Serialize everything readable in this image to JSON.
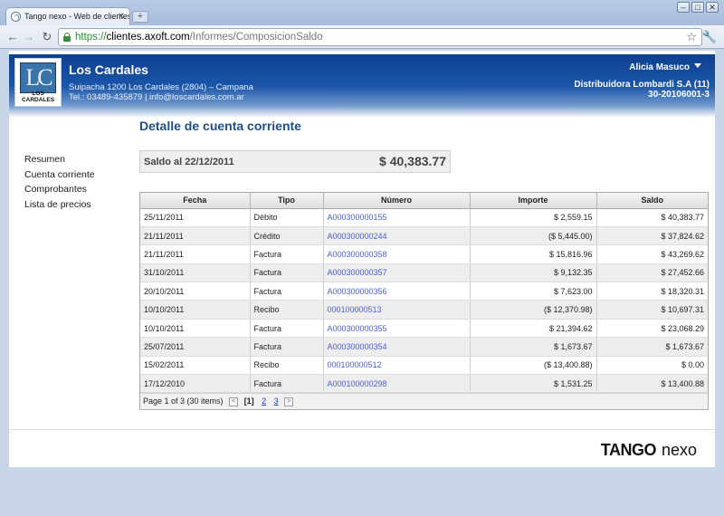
{
  "browser": {
    "tab_title": "Tango nexo - Web de clientes",
    "url_scheme": "https://",
    "url_host": "clientes.axoft.com",
    "url_path": "/Informes/ComposicionSaldo"
  },
  "header": {
    "logo_letters": "LC",
    "logo_text": "LOS CARDALES",
    "company_name": "Los Cardales",
    "address": "Suipacha 1200 Los Cardales (2804) – Campana",
    "contact": "Tel.: 03489-435879 | info@loscardales.com.ar",
    "user_name": "Alicia Masuco",
    "distributor": "Distribuidora Lombardi S.A (11)",
    "cuit": "30-20106001-3"
  },
  "menu": {
    "items": [
      "Resumen",
      "Cuenta corriente",
      "Comprobantes",
      "Lista de precios"
    ]
  },
  "main": {
    "title": "Detalle de cuenta corriente",
    "balance_label": "Saldo al 22/12/2011",
    "balance_value": "$ 40,383.77",
    "columns": [
      "Fecha",
      "Tipo",
      "Número",
      "Importe",
      "Saldo"
    ],
    "rows": [
      [
        "25/11/2011",
        "Débito",
        "A000300000155",
        "$ 2,559.15",
        "$ 40,383.77"
      ],
      [
        "21/11/2011",
        "Crédito",
        "A000300000244",
        "($ 5,445.00)",
        "$ 37,824.62"
      ],
      [
        "21/11/2011",
        "Factura",
        "A000300000358",
        "$ 15,816.96",
        "$ 43,269.62"
      ],
      [
        "31/10/2011",
        "Factura",
        "A000300000357",
        "$ 9,132.35",
        "$ 27,452.66"
      ],
      [
        "20/10/2011",
        "Factura",
        "A000300000356",
        "$ 7,623.00",
        "$ 18,320.31"
      ],
      [
        "10/10/2011",
        "Recibo",
        "000100000513",
        "($ 12,370.98)",
        "$ 10,697.31"
      ],
      [
        "10/10/2011",
        "Factura",
        "A000300000355",
        "$ 21,394.62",
        "$ 23,068.29"
      ],
      [
        "25/07/2011",
        "Factura",
        "A000300000354",
        "$ 1,673.67",
        "$ 1,673.67"
      ],
      [
        "15/02/2011",
        "Recibo",
        "000100000512",
        "($ 13,400.88)",
        "$ 0.00"
      ],
      [
        "17/12/2010",
        "Factura",
        "A000100000298",
        "$ 1,531.25",
        "$ 13,400.88"
      ]
    ],
    "pager": {
      "summary": "Page 1 of 3 (30 items)",
      "prev": "<",
      "current": "[1]",
      "page2": "2",
      "page3": "3",
      "next": ">"
    }
  },
  "footer": {
    "brand_bold": "TANGO",
    "brand_light": "nexo"
  }
}
